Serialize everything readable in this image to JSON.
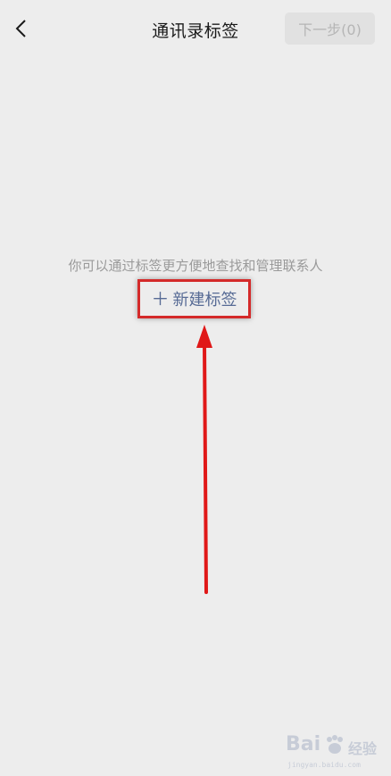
{
  "navbar": {
    "title": "通讯录标签",
    "back_icon": "chevron-left-icon",
    "next_label": "下一步(0)"
  },
  "empty_state": {
    "hint": "你可以通过标签更方便地查找和管理联系人",
    "new_tag_icon": "plus-icon",
    "new_tag_label": "新建标签"
  },
  "annotation": {
    "highlight_color": "#d42a2a",
    "arrow_color": "#e01818"
  },
  "watermark": {
    "brand": "Bai",
    "brand_suffix": "经验",
    "url": "jingyan.baidu.com"
  }
}
